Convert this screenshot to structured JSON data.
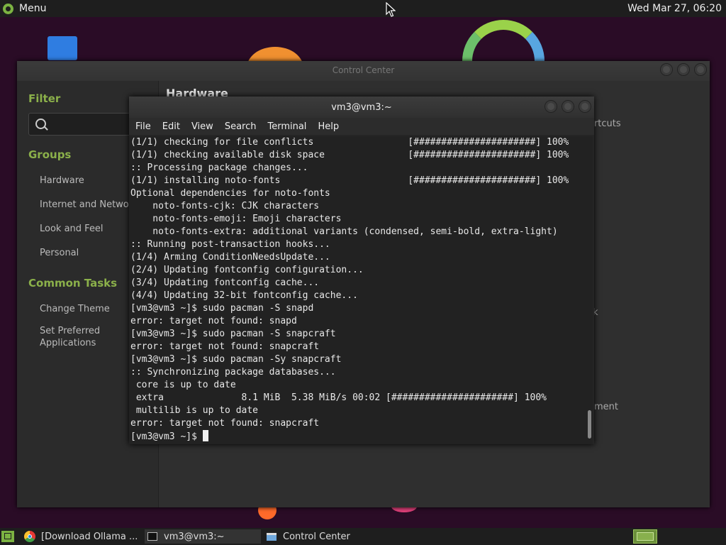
{
  "top_panel": {
    "menu_label": "Menu",
    "clock": "Wed Mar 27, 06:20"
  },
  "control_center": {
    "title": "Control Center",
    "filter_heading": "Filter",
    "groups_heading": "Groups",
    "groups": [
      "Hardware",
      "Internet and Network",
      "Look and Feel",
      "Personal"
    ],
    "common_tasks_heading": "Common Tasks",
    "tasks": [
      "Change Theme",
      "Set Preferred\nApplications"
    ],
    "main_title": "Hardware",
    "peek_shortcuts": "ortcuts",
    "peek_k": "k",
    "peek_ement": "ement"
  },
  "terminal": {
    "title": "vm3@vm3:~",
    "menu": [
      "File",
      "Edit",
      "View",
      "Search",
      "Terminal",
      "Help"
    ],
    "lines": [
      "(1/1) checking for file conflicts                 [######################] 100%",
      "(1/1) checking available disk space               [######################] 100%",
      ":: Processing package changes...",
      "(1/1) installing noto-fonts                       [######################] 100%",
      "Optional dependencies for noto-fonts",
      "    noto-fonts-cjk: CJK characters",
      "    noto-fonts-emoji: Emoji characters",
      "    noto-fonts-extra: additional variants (condensed, semi-bold, extra-light)",
      ":: Running post-transaction hooks...",
      "(1/4) Arming ConditionNeedsUpdate...",
      "(2/4) Updating fontconfig configuration...",
      "(3/4) Updating fontconfig cache...",
      "(4/4) Updating 32-bit fontconfig cache...",
      "[vm3@vm3 ~]$ sudo pacman -S snapd",
      "error: target not found: snapd",
      "[vm3@vm3 ~]$ sudo pacman -S snapcraft",
      "error: target not found: snapcraft",
      "[vm3@vm3 ~]$ sudo pacman -Sy snapcraft",
      ":: Synchronizing package databases...",
      " core is up to date",
      " extra              8.1 MiB  5.38 MiB/s 00:02 [######################] 100%",
      " multilib is up to date",
      "error: target not found: snapcraft"
    ],
    "prompt": "[vm3@vm3 ~]$ "
  },
  "taskbar": {
    "items": [
      {
        "label": "[Download Ollama ...",
        "icon": "chrome-icon"
      },
      {
        "label": "vm3@vm3:~",
        "icon": "terminal-icon"
      },
      {
        "label": "Control Center",
        "icon": "control-center-icon"
      }
    ]
  }
}
